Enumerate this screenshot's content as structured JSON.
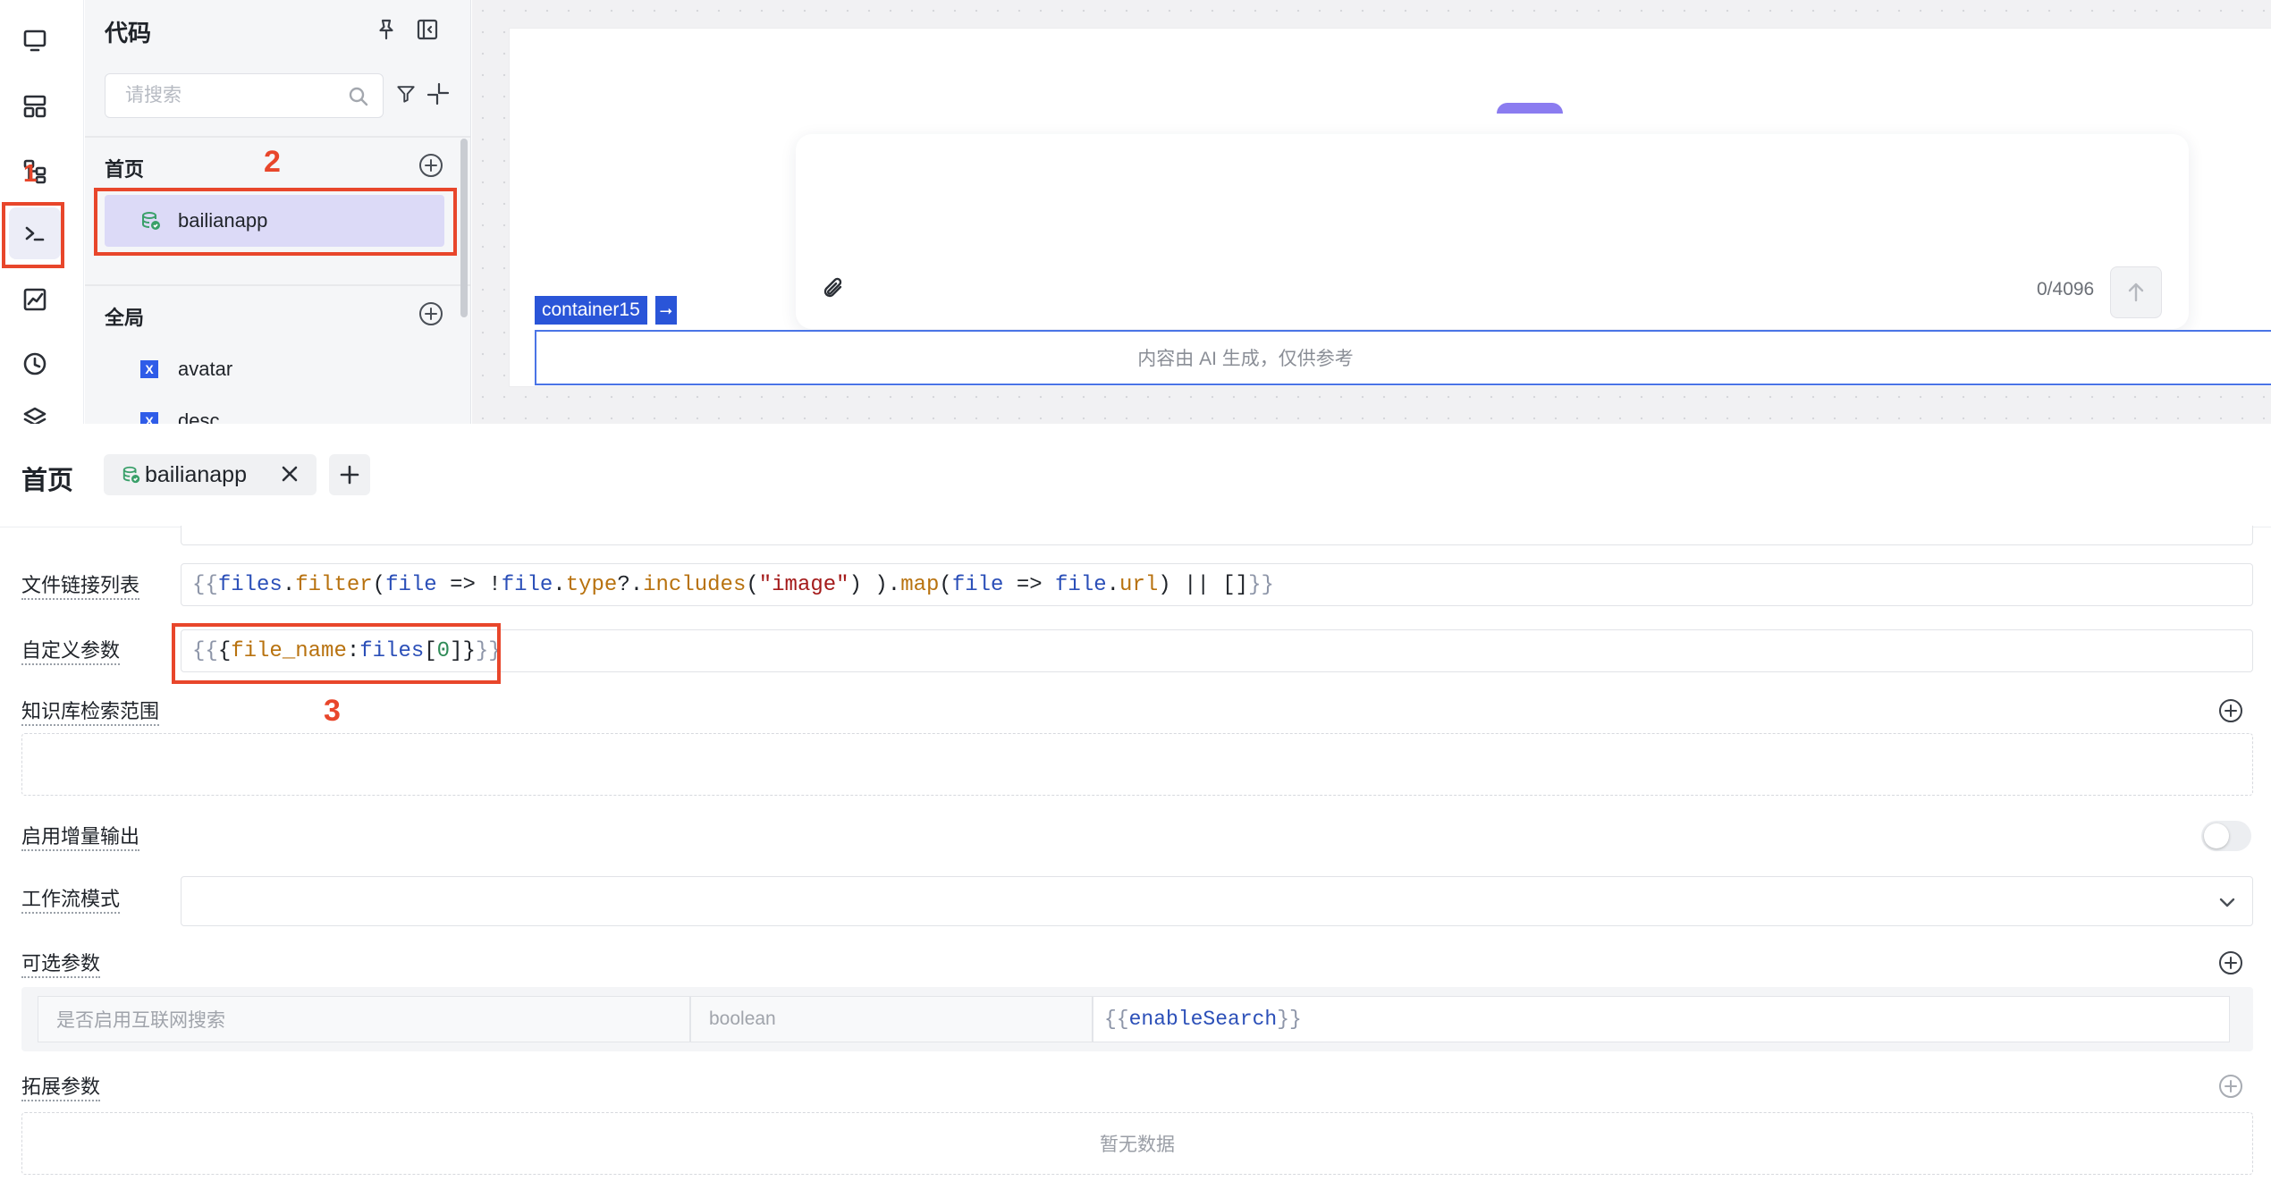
{
  "rail": {
    "items": [
      {
        "name": "page-icon",
        "label": ""
      },
      {
        "name": "layout-icon",
        "label": ""
      },
      {
        "name": "flow-icon",
        "label": ""
      },
      {
        "name": "terminal-icon",
        "label": ""
      },
      {
        "name": "chart-icon",
        "label": ""
      },
      {
        "name": "clock-icon",
        "label": ""
      },
      {
        "name": "layers-icon",
        "label": ""
      }
    ],
    "active": "terminal-icon"
  },
  "annotations": {
    "n1": "1",
    "n2": "2",
    "n3": "3",
    "color": "#e8462b"
  },
  "code_panel": {
    "title": "代码",
    "search_placeholder": "请搜索",
    "home_section": "首页",
    "home_item": "bailianapp",
    "global_section": "全局",
    "global_items": [
      "avatar",
      "desc"
    ]
  },
  "canvas": {
    "container_label": "container15",
    "char_count": "0/4096",
    "disclaimer": "内容由 AI 生成，仅供参考"
  },
  "editor": {
    "title": "首页",
    "tab_label": "bailianapp",
    "rows": {
      "file_links_label": "文件链接列表",
      "custom_params_label": "自定义参数",
      "kb_scope_label": "知识库检索范围",
      "incremental_label": "启用增量输出",
      "workflow_mode_label": "工作流模式",
      "optional_params_label": "可选参数",
      "extended_params_label": "拓展参数"
    },
    "file_links_code": "{{files.filter(file => !file.type?.includes(\"image\") ).map(file => file.url) || []}}",
    "custom_params_code": "{{{file_name:files[0]}}}",
    "incremental_enabled": false,
    "optional_param": {
      "name_placeholder": "是否启用互联网搜索",
      "type_placeholder": "boolean",
      "value": "{{enableSearch}}"
    },
    "empty_text": "暂无数据"
  },
  "colors": {
    "accent": "#2a55d8",
    "selection": "#dcdaf7",
    "purple": "#8b7cf0"
  }
}
